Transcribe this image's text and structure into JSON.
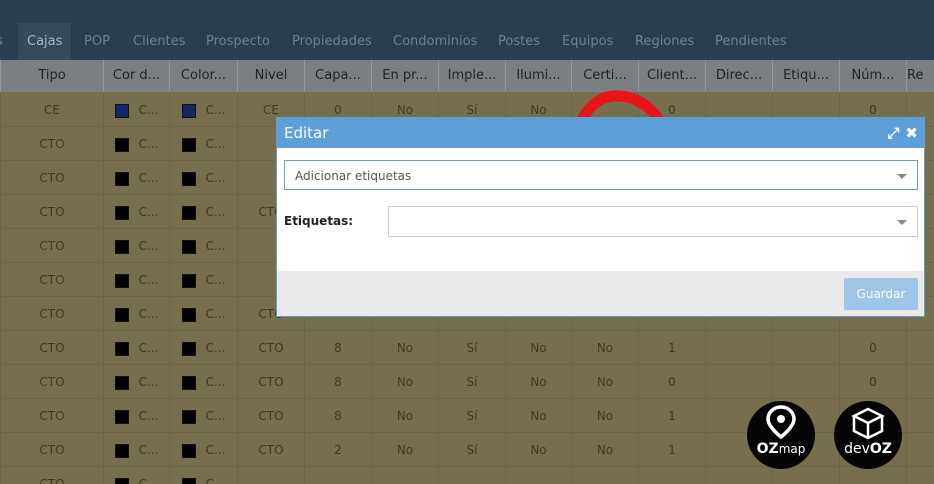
{
  "tabs": [
    "Cajas",
    "POP",
    "Clientes",
    "Prospecto",
    "Propiedades",
    "Condominios",
    "Postes",
    "Equipos",
    "Regiones",
    "Pendientes"
  ],
  "columns": [
    "Tipo",
    "Cor d...",
    "Color...",
    "Nivel",
    "Capa...",
    "En pr...",
    "Imple...",
    "Ilumi...",
    "Certi...",
    "Client...",
    "Direc...",
    "Etiqu...",
    "Núm...",
    "Re"
  ],
  "rows": [
    {
      "tipo": "CE",
      "c1": "C...",
      "c2": "C...",
      "nivel": "CE",
      "capa": "0",
      "enpr": "No",
      "imple": "Sí",
      "ilumi": "No",
      "certi": "",
      "client": "0",
      "num": "0"
    },
    {
      "tipo": "CTO",
      "c1": "C...",
      "c2": "C...",
      "nivel": "",
      "capa": "",
      "enpr": "",
      "imple": "",
      "ilumi": "",
      "certi": "",
      "client": "",
      "num": ""
    },
    {
      "tipo": "CTO",
      "c1": "C...",
      "c2": "C...",
      "nivel": "",
      "capa": "",
      "enpr": "",
      "imple": "",
      "ilumi": "",
      "certi": "",
      "client": "",
      "num": ""
    },
    {
      "tipo": "CTO",
      "c1": "C...",
      "c2": "C...",
      "nivel": "CTO",
      "capa": "",
      "enpr": "",
      "imple": "",
      "ilumi": "",
      "certi": "",
      "client": "",
      "num": ""
    },
    {
      "tipo": "CTO",
      "c1": "C...",
      "c2": "C...",
      "nivel": "",
      "capa": "",
      "enpr": "",
      "imple": "",
      "ilumi": "",
      "certi": "",
      "client": "",
      "num": ""
    },
    {
      "tipo": "CTO",
      "c1": "C...",
      "c2": "C...",
      "nivel": "",
      "capa": "",
      "enpr": "",
      "imple": "",
      "ilumi": "",
      "certi": "",
      "client": "",
      "num": ""
    },
    {
      "tipo": "CTO",
      "c1": "C...",
      "c2": "C...",
      "nivel": "CTO",
      "capa": "",
      "enpr": "",
      "imple": "",
      "ilumi": "",
      "certi": "",
      "client": "",
      "num": ""
    },
    {
      "tipo": "CTO",
      "c1": "C...",
      "c2": "C...",
      "nivel": "CTO",
      "capa": "8",
      "enpr": "No",
      "imple": "Sí",
      "ilumi": "No",
      "certi": "No",
      "client": "1",
      "num": "0"
    },
    {
      "tipo": "CTO",
      "c1": "C...",
      "c2": "C...",
      "nivel": "CTO",
      "capa": "8",
      "enpr": "No",
      "imple": "Sí",
      "ilumi": "No",
      "certi": "No",
      "client": "0",
      "num": "0"
    },
    {
      "tipo": "CTO",
      "c1": "C...",
      "c2": "C...",
      "nivel": "CTO",
      "capa": "8",
      "enpr": "No",
      "imple": "Sí",
      "ilumi": "No",
      "certi": "No",
      "client": "1",
      "num": "0"
    },
    {
      "tipo": "CTO",
      "c1": "C...",
      "c2": "C...",
      "nivel": "CTO",
      "capa": "2",
      "enpr": "No",
      "imple": "Sí",
      "ilumi": "No",
      "certi": "No",
      "client": "1",
      "num": "0"
    },
    {
      "tipo": "CTO",
      "c1": "C...",
      "c2": "C...",
      "nivel": "",
      "capa": "",
      "enpr": "",
      "imple": "",
      "ilumi": "",
      "certi": "",
      "client": "",
      "num": ""
    }
  ],
  "modal": {
    "title": "Editar",
    "action_select": "Adicionar etiquetas",
    "tags_label": "Etiquetas:",
    "tags_value": "",
    "save_button": "Guardar"
  },
  "logos": {
    "ozmap_oz": "OZ",
    "ozmap_map": "map",
    "devoz_dev": "dev",
    "devoz_oz": "OZ"
  },
  "colors": {
    "modal_header": "#5c9fd9",
    "arrow": "#e8141c",
    "save_button": "#9fc5e8",
    "topbar": "#2c3d4f"
  },
  "icons": [
    "maximize-icon",
    "close-icon",
    "chevron-down-icon",
    "curved-arrow-icon",
    "map-pin-icon",
    "devoz-cube-icon"
  ]
}
